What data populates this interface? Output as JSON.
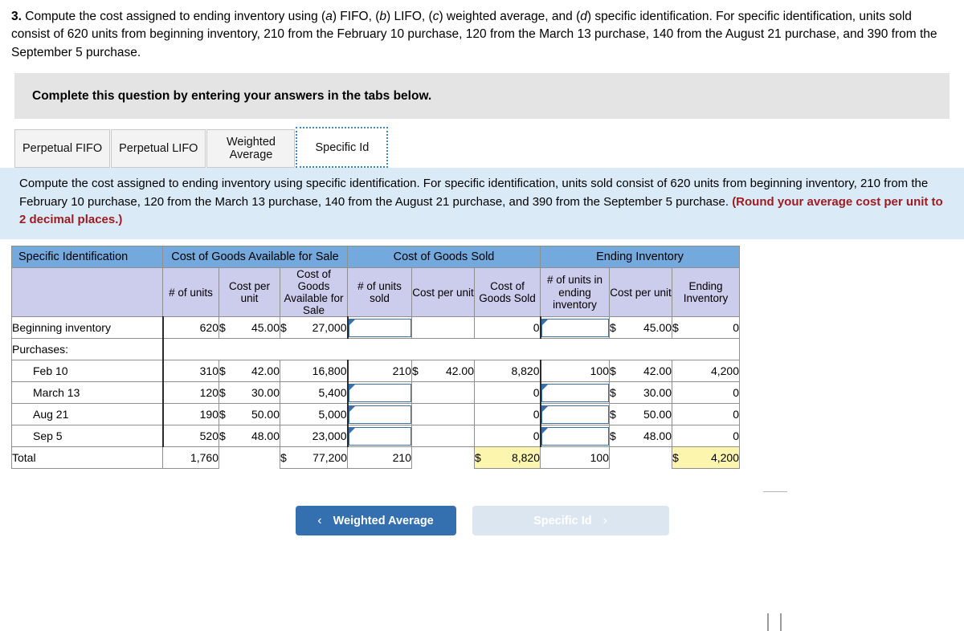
{
  "prompt": {
    "number": "3.",
    "line1_a": "Compute the cost assigned to ending inventory using (",
    "text": "Compute the cost assigned to ending inventory using (a) FIFO, (b) LIFO, (c) weighted average, and (d) specific identification. For specific identification, units sold consist of 620 units from beginning inventory, 210 from the February 10 purchase, 120 from the March 13 purchase, 140 from the August 21 purchase, and 390 from the September 5 purchase."
  },
  "banner": {
    "text": "Complete this question by entering your answers in the tabs below."
  },
  "tabs": [
    {
      "label": "Perpetual FIFO",
      "active": false
    },
    {
      "label": "Perpetual LIFO",
      "active": false
    },
    {
      "label": "Weighted Average",
      "active": false
    },
    {
      "label": "Specific Id",
      "active": true
    }
  ],
  "instruction": {
    "body": "Compute the cost assigned to ending inventory using specific identification. For specific identification, units sold consist of 620 units from beginning inventory, 210 from the February 10 purchase, 120 from the March 13 purchase, 140 from the August 21 purchase, and 390 from the September 5 purchase.",
    "round_note": "(Round your average cost per unit to 2 decimal places.)"
  },
  "table": {
    "corner_label": "Specific Identification",
    "groups": [
      {
        "label": "Cost of Goods Available for Sale",
        "span": 3
      },
      {
        "label": "Cost of Goods Sold",
        "span": 3
      },
      {
        "label": "Ending Inventory",
        "span": 3
      }
    ],
    "subheaders": [
      "# of units",
      "Cost per unit",
      "Cost of Goods Available for Sale",
      "# of units sold",
      "Cost per unit",
      "Cost of Goods Sold",
      "# of units in ending inventory",
      "Cost per unit",
      "Ending Inventory"
    ],
    "rows": [
      {
        "label": "Beginning inventory",
        "indent": false,
        "avail_units": "620",
        "avail_cost_sym": "$",
        "avail_cost": "45.00",
        "avail_total_sym": "$",
        "avail_total": "27,000",
        "sold_units": "",
        "sold_units_input": true,
        "sold_cost_sym": "",
        "sold_cost": "",
        "sold_total": "0",
        "end_units": "",
        "end_units_input": true,
        "end_cost_sym": "$",
        "end_cost": "45.00",
        "end_total_sym": "$",
        "end_total": "0"
      },
      {
        "label": "Purchases:",
        "indent": false,
        "separator": true
      },
      {
        "label": "Feb 10",
        "indent": true,
        "avail_units": "310",
        "avail_cost_sym": "$",
        "avail_cost": "42.00",
        "avail_total_sym": "",
        "avail_total": "16,800",
        "sold_units": "210",
        "sold_units_input": false,
        "sold_cost_sym": "$",
        "sold_cost": "42.00",
        "sold_total": "8,820",
        "end_units": "100",
        "end_units_input": false,
        "end_cost_sym": "$",
        "end_cost": "42.00",
        "end_total_sym": "",
        "end_total": "4,200"
      },
      {
        "label": "March 13",
        "indent": true,
        "avail_units": "120",
        "avail_cost_sym": "$",
        "avail_cost": "30.00",
        "avail_total_sym": "",
        "avail_total": "5,400",
        "sold_units": "",
        "sold_units_input": true,
        "sold_cost_sym": "",
        "sold_cost": "",
        "sold_total": "0",
        "end_units": "",
        "end_units_input": true,
        "end_cost_sym": "$",
        "end_cost": "30.00",
        "end_total_sym": "",
        "end_total": "0"
      },
      {
        "label": "Aug 21",
        "indent": true,
        "avail_units": "190",
        "avail_cost_sym": "$",
        "avail_cost": "50.00",
        "avail_total_sym": "",
        "avail_total": "5,000",
        "sold_units": "",
        "sold_units_input": true,
        "sold_cost_sym": "",
        "sold_cost": "",
        "sold_total": "0",
        "end_units": "",
        "end_units_input": true,
        "end_cost_sym": "$",
        "end_cost": "50.00",
        "end_total_sym": "",
        "end_total": "0"
      },
      {
        "label": "Sep 5",
        "indent": true,
        "avail_units": "520",
        "avail_cost_sym": "$",
        "avail_cost": "48.00",
        "avail_total_sym": "",
        "avail_total": "23,000",
        "sold_units": "",
        "sold_units_input": true,
        "sold_cost_sym": "",
        "sold_cost": "",
        "sold_total": "0",
        "end_units": "",
        "end_units_input": true,
        "end_cost_sym": "$",
        "end_cost": "48.00",
        "end_total_sym": "",
        "end_total": "0"
      }
    ],
    "total_row": {
      "label": "Total",
      "avail_units": "1,760",
      "avail_total_sym": "$",
      "avail_total": "77,200",
      "sold_units": "210",
      "sold_total_sym": "$",
      "sold_total": "8,820",
      "end_units": "100",
      "end_total_sym": "$",
      "end_total": "4,200"
    }
  },
  "nav": {
    "prev_label": "Weighted Average",
    "prev_chevron": "‹",
    "next_label": "Specific Id",
    "next_chevron": "›"
  },
  "colors": {
    "group_header": "#74a9dd",
    "sub_header": "#ccccec",
    "instruction_bg": "#daeaf7",
    "banner_bg": "#e4e4e4",
    "highlight": "#fbf5ae",
    "accent_button": "#346fb0",
    "round_note": "#9c1c21"
  }
}
